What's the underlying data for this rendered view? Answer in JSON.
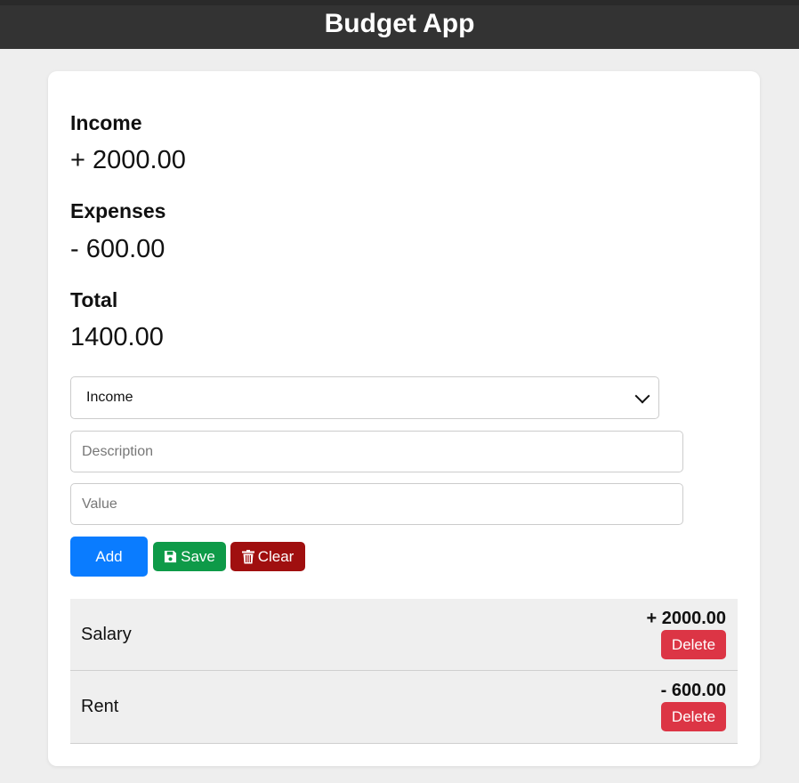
{
  "header": {
    "title": "Budget App"
  },
  "summary": {
    "income_label": "Income",
    "income_value": "+ 2000.00",
    "expenses_label": "Expenses",
    "expenses_value": "- 600.00",
    "total_label": "Total",
    "total_value": "1400.00"
  },
  "form": {
    "type_selected": "Income",
    "description_placeholder": "Description",
    "value_placeholder": "Value",
    "add_label": "Add",
    "save_label": "Save",
    "clear_label": "Clear",
    "save_icon": "floppy-disk-icon",
    "clear_icon": "trash-icon"
  },
  "transactions": [
    {
      "description": "Salary",
      "amount": "+ 2000.00",
      "delete_label": "Delete"
    },
    {
      "description": "Rent",
      "amount": "- 600.00",
      "delete_label": "Delete"
    }
  ],
  "colors": {
    "header_bg": "#333333",
    "add_button": "#0a7cff",
    "save_button": "#0e9a48",
    "clear_button": "#a00f0f",
    "delete_button": "#dc3545",
    "page_bg": "#eeeeee"
  }
}
